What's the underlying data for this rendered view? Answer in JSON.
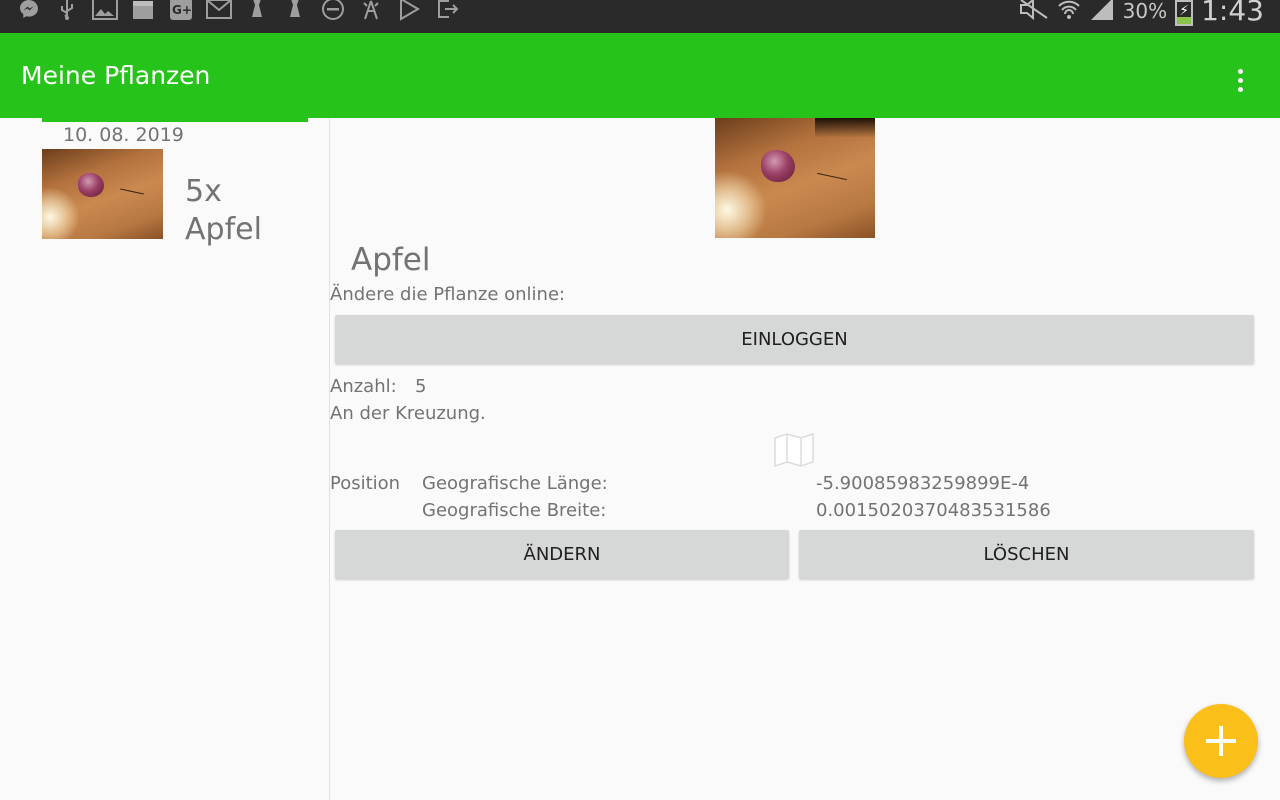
{
  "status_bar": {
    "icons": [
      "messenger-icon",
      "usb-icon",
      "image-icon",
      "calendar-icon",
      "google-plus-icon",
      "mail-icon",
      "chess-piece-icon",
      "chess-piece-icon",
      "do-not-disturb-icon",
      "signal-tower-icon",
      "play-store-icon",
      "exit-icon"
    ],
    "battery": "30%",
    "time": "1:43"
  },
  "app_bar": {
    "title": "Meine Pflanzen",
    "menu_icon": "overflow-menu-icon"
  },
  "plant_list": [
    {
      "date": "10. 08. 2019",
      "quantity": "5x",
      "name": "Apfel"
    }
  ],
  "detail": {
    "name": "Apfel",
    "online_prompt": "Ändere die Pflanze online:",
    "login_button": "EINLOGGEN",
    "count_label": "Anzahl:",
    "count_value": "5",
    "description": "An der Kreuzung.",
    "map_icon": "map-icon",
    "position_label": "Position",
    "longitude_label": "Geografische Länge:",
    "longitude_value": "-5.90085983259899E-4",
    "latitude_label": "Geografische Breite:",
    "latitude_value": "0.0015020370483531586",
    "edit_button": "ÄNDERN",
    "delete_button": "LÖSCHEN"
  },
  "fab": {
    "icon": "add-icon"
  },
  "colors": {
    "app_bar": "#26c31a",
    "accent": "#26c31a",
    "fab": "#fbbf1a",
    "button": "#d6d7d7",
    "text": "#737373"
  }
}
